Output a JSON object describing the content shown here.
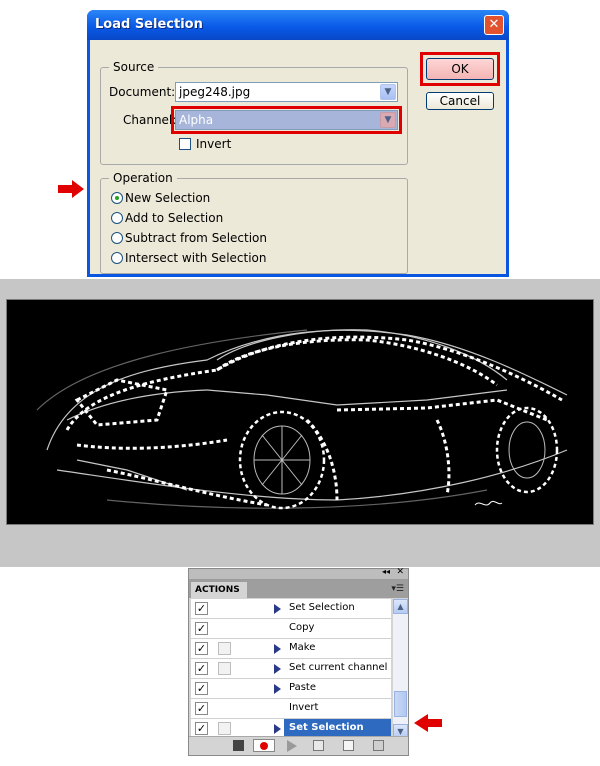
{
  "dialog": {
    "title": "Load Selection",
    "source": {
      "legend": "Source",
      "document_label": "Document:",
      "document_value": "jpeg248.jpg",
      "channel_label": "Channel:",
      "channel_value": "Alpha",
      "invert_label": "Invert",
      "invert_checked": false
    },
    "operation": {
      "legend": "Operation",
      "options": [
        {
          "label": "New Selection",
          "selected": true
        },
        {
          "label": "Add to Selection",
          "selected": false
        },
        {
          "label": "Subtract from Selection",
          "selected": false
        },
        {
          "label": "Intersect with Selection",
          "selected": false
        }
      ]
    },
    "ok_label": "OK",
    "cancel_label": "Cancel"
  },
  "actions_panel": {
    "tab_label": "ACTIONS",
    "rows": [
      {
        "label": "Set Selection",
        "checked": true,
        "dialog_toggle": false,
        "expandable": true,
        "selected": false
      },
      {
        "label": "Copy",
        "checked": true,
        "dialog_toggle": false,
        "expandable": false,
        "selected": false
      },
      {
        "label": "Make",
        "checked": true,
        "dialog_toggle": true,
        "expandable": true,
        "selected": false
      },
      {
        "label": "Set current channel",
        "checked": true,
        "dialog_toggle": true,
        "expandable": true,
        "selected": false
      },
      {
        "label": "Paste",
        "checked": true,
        "dialog_toggle": false,
        "expandable": true,
        "selected": false
      },
      {
        "label": "Invert",
        "checked": true,
        "dialog_toggle": false,
        "expandable": false,
        "selected": false
      },
      {
        "label": "Set Selection",
        "checked": true,
        "dialog_toggle": true,
        "expandable": true,
        "selected": true
      }
    ]
  },
  "colors": {
    "highlight_red": "#e00000",
    "xp_blue": "#0a56e0",
    "selection_blue": "#2e6ac0"
  }
}
